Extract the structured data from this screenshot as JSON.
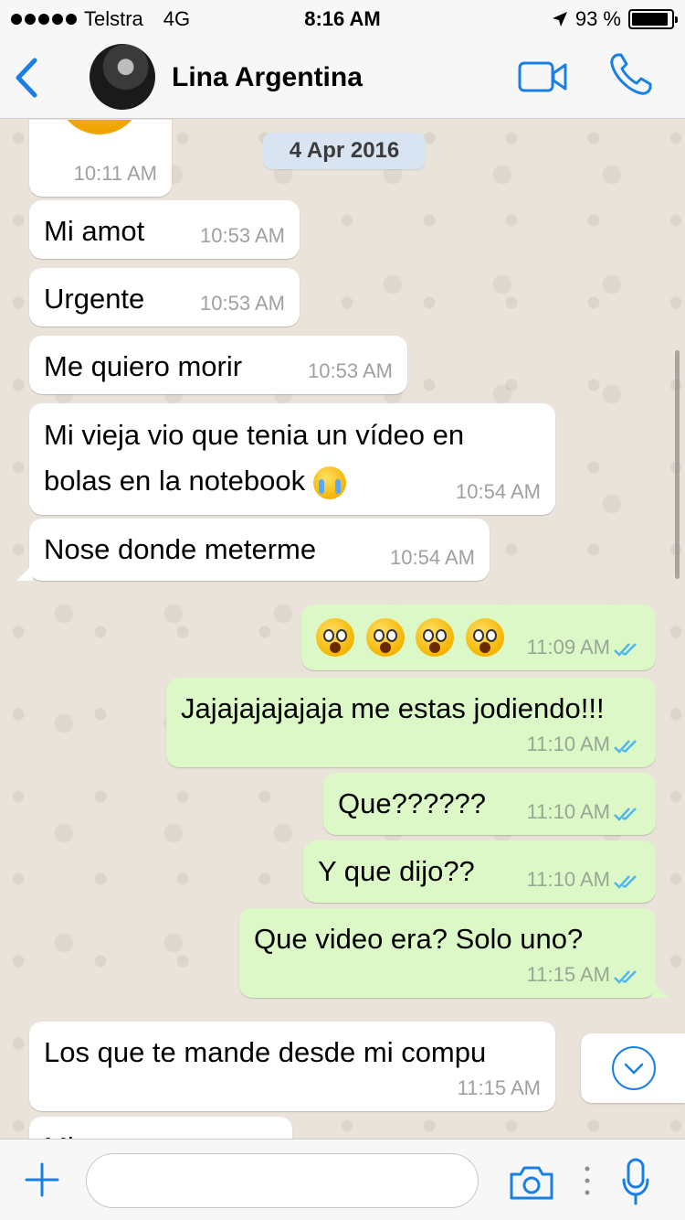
{
  "status_bar": {
    "carrier": "Telstra",
    "network": "4G",
    "time": "8:16 AM",
    "battery_percent": "93 %",
    "battery_level": 0.93
  },
  "header": {
    "back_icon": "chevron-left-icon",
    "contact_name": "Lina Argentina",
    "video_icon": "video-camera-icon",
    "call_icon": "phone-icon"
  },
  "chat": {
    "date_chip": "4 Apr 2016",
    "messages": [
      {
        "direction": "in",
        "text": "",
        "emoji": "kissing-heart",
        "time": "10:11 AM"
      },
      {
        "direction": "in",
        "text": "Mi amot",
        "time": "10:53 AM"
      },
      {
        "direction": "in",
        "text": "Urgente",
        "time": "10:53 AM"
      },
      {
        "direction": "in",
        "text": "Me quiero morir",
        "time": "10:53 AM"
      },
      {
        "direction": "in",
        "text": "Mi vieja vio que tenia un vídeo en bolas en la notebook",
        "emoji": "loudly-crying-face",
        "time": "10:54 AM"
      },
      {
        "direction": "in",
        "text": "Nose donde meterme",
        "time": "10:54 AM"
      },
      {
        "direction": "out",
        "text": "",
        "emoji": "face-screaming-in-fear x4",
        "time": "11:09 AM",
        "status": "read"
      },
      {
        "direction": "out",
        "text": "Jajajajajajaja me estas jodiendo!!!",
        "time": "11:10 AM",
        "status": "read"
      },
      {
        "direction": "out",
        "text": "Que??????",
        "time": "11:10 AM",
        "status": "read"
      },
      {
        "direction": "out",
        "text": "Y que dijo??",
        "time": "11:10 AM",
        "status": "read"
      },
      {
        "direction": "out",
        "text": "Que video era? Solo uno?",
        "time": "11:15 AM",
        "status": "read"
      },
      {
        "direction": "in",
        "text": "Los que te mande desde mi compu",
        "time": "11:15 AM"
      },
      {
        "direction": "in",
        "text": "Mi amor",
        "time": ""
      }
    ],
    "scroll_down_icon": "chevron-down-circle-icon"
  },
  "input_bar": {
    "plus_icon": "plus-icon",
    "message_placeholder": "",
    "camera_icon": "camera-icon",
    "mic_icon": "microphone-icon"
  },
  "colors": {
    "accent": "#1a7fe5",
    "outgoing_bubble": "#dcf8c6",
    "incoming_bubble": "#ffffff",
    "read_tick": "#4fb6ec"
  }
}
